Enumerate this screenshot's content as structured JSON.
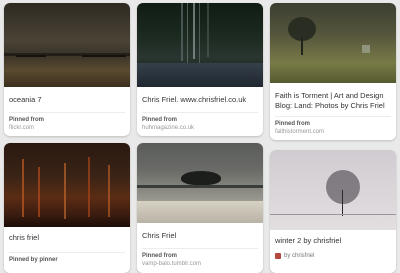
{
  "pins": [
    {
      "description": "oceania 7",
      "attribution_label": "Pinned from",
      "attribution_source": "flickr.com"
    },
    {
      "description": "Chris Friel. www.chrisfriel.co.uk",
      "attribution_label": "Pinned from",
      "attribution_source": "huhmagazine.co.uk"
    },
    {
      "description": "Faith is Torment | Art and Design Blog: Land: Photos by Chris Friel",
      "attribution_label": "Pinned from",
      "attribution_source": "faithistorment.com"
    },
    {
      "description": "chris friel",
      "attribution_label": "Pinned by pinner",
      "attribution_source": ""
    },
    {
      "description": "Chris Friel",
      "attribution_label": "Pinned from",
      "attribution_source": "vamp-balo.tumblr.com"
    },
    {
      "description": "winter 2 by chrisfriel",
      "attribution_label": "",
      "attribution_source": "by chrisfriel"
    }
  ]
}
